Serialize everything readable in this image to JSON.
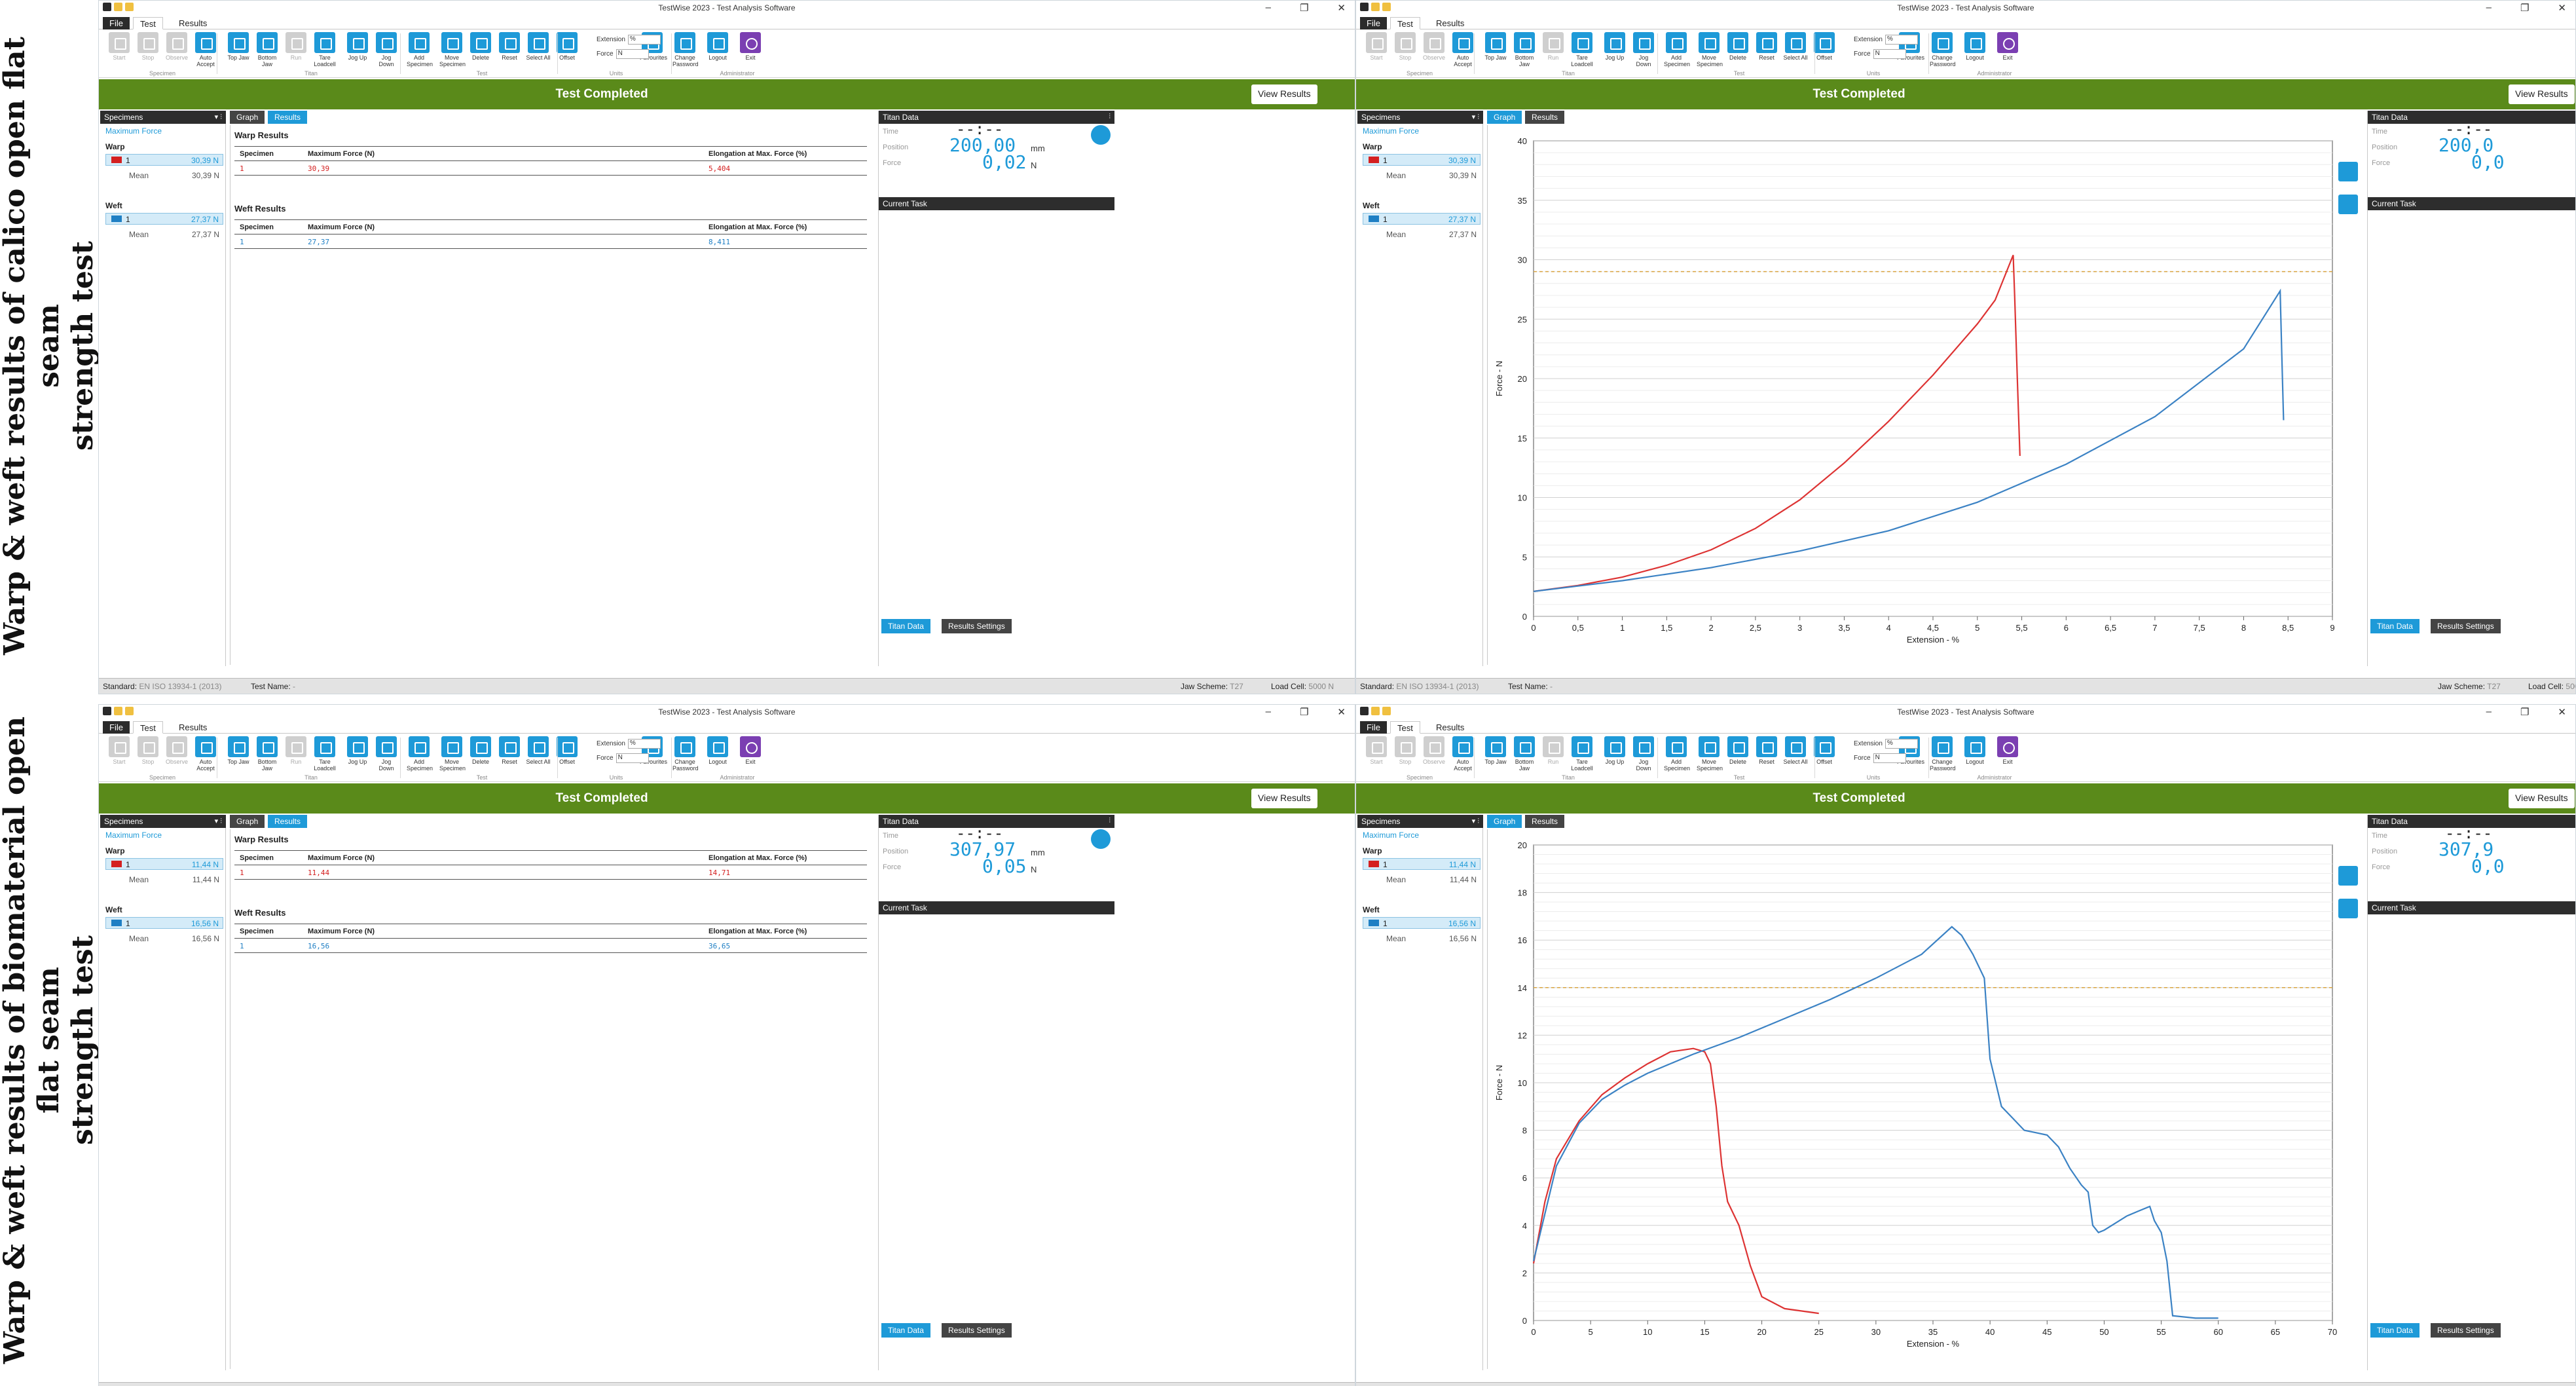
{
  "labels": {
    "top": "Warp & weft results of calico open flat seam\nstrength test",
    "bottom": "Warp & weft results of biomaterial open flat seam\nstrength test"
  },
  "app": {
    "title": "TestWise 2023 - Test Analysis Software",
    "menu": {
      "file": "File",
      "test": "Test",
      "results": "Results"
    }
  },
  "ribbon": {
    "buttons": [
      {
        "label": "Start",
        "icon": "play-icon",
        "disabled": true
      },
      {
        "label": "Stop",
        "icon": "stop-icon",
        "disabled": true
      },
      {
        "label": "Observe",
        "icon": "observe-icon",
        "disabled": true
      },
      {
        "label": "Auto Accept",
        "icon": "auto-accept-icon"
      },
      {
        "label": "Top Jaw",
        "icon": "top-jaw-icon"
      },
      {
        "label": "Bottom Jaw",
        "icon": "bottom-jaw-icon"
      },
      {
        "label": "Run",
        "icon": "run-icon",
        "disabled": true
      },
      {
        "label": "Tare Loadcell",
        "icon": "tare-icon"
      },
      {
        "label": "Jog Up",
        "icon": "jog-up-icon"
      },
      {
        "label": "Jog Down",
        "icon": "jog-down-icon"
      },
      {
        "label": "Add Specimen",
        "icon": "add-specimen-icon"
      },
      {
        "label": "Move Specimen",
        "icon": "move-specimen-icon"
      },
      {
        "label": "Delete",
        "icon": "delete-icon"
      },
      {
        "label": "Reset",
        "icon": "reset-icon"
      },
      {
        "label": "Select All",
        "icon": "select-all-icon"
      },
      {
        "label": "Offset",
        "icon": "offset-icon"
      },
      {
        "label": "Favourites",
        "icon": "star-icon"
      },
      {
        "label": "Change Password",
        "icon": "password-icon"
      },
      {
        "label": "Logout",
        "icon": "logout-icon"
      },
      {
        "label": "Exit",
        "icon": "power-icon"
      }
    ],
    "groups": {
      "specimen": "Specimen",
      "titan": "Titan",
      "test": "Test",
      "units": "Units",
      "administrator": "Administrator"
    },
    "units": {
      "extension_label": "Extension",
      "extension_value": "%",
      "force_label": "Force",
      "force_value": "N"
    }
  },
  "status": {
    "banner": "Test Completed",
    "view_results": "View Results",
    "standard_label": "Standard:",
    "standard_value": "EN ISO 13934-1 (2013)",
    "test_name_label": "Test Name:",
    "test_name_value": "-",
    "jaw_label": "Jaw Scheme:",
    "jaw_value": "T27",
    "load_label": "Load Cell:",
    "load_value": "5000 N"
  },
  "panels": {
    "specimens": "Specimens",
    "max_force": "Maximum Force",
    "warp": "Warp",
    "weft": "Weft",
    "mean": "Mean",
    "graph_tab": "Graph",
    "results_tab": "Results",
    "titan_data": "Titan Data",
    "time": "Time",
    "time_value": "--:--",
    "position": "Position",
    "force": "Force",
    "current_task": "Current Task",
    "titan_data_tab": "Titan Data",
    "results_settings_tab": "Results Settings",
    "warp_results": "Warp Results",
    "weft_results": "Weft Results",
    "col_specimen": "Specimen",
    "col_max_force": "Maximum Force (N)",
    "col_elong": "Elongation at Max. Force (%)"
  },
  "tests": {
    "calico": {
      "warp_num": "1",
      "warp_value": "30,39 N",
      "warp_mean": "30,39 N",
      "weft_num": "1",
      "weft_value": "27,37 N",
      "weft_mean": "27,37 N",
      "warp_table_force": "30,39",
      "warp_table_elong": "5,404",
      "weft_table_force": "27,37",
      "weft_table_elong": "8,411",
      "position_value": "200,00",
      "position_unit": "mm",
      "force_value": "0,02",
      "force_unit": "N",
      "position_partial": "200,0",
      "force_partial": "0,0"
    },
    "bio": {
      "warp_num": "1",
      "warp_value": "11,44 N",
      "warp_mean": "11,44 N",
      "weft_num": "1",
      "weft_value": "16,56 N",
      "weft_mean": "16,56 N",
      "warp_table_force": "11,44",
      "warp_table_elong": "14,71",
      "weft_table_force": "16,56",
      "weft_table_elong": "36,65",
      "position_value": "307,97",
      "position_unit": "mm",
      "force_value": "0,05",
      "force_unit": "N",
      "position_partial": "307,9",
      "force_partial": "0,0"
    }
  },
  "chart_data": [
    {
      "type": "line",
      "xlabel": "Extension - %",
      "ylabel": "Force - N",
      "xlim": [
        0,
        9
      ],
      "ylim": [
        0,
        40
      ],
      "xticks": [
        "0",
        "0,5",
        "1",
        "1,5",
        "2",
        "2,5",
        "3",
        "3,5",
        "4",
        "4,5",
        "5",
        "5,5",
        "6",
        "6,5",
        "7",
        "7,5",
        "8",
        "8,5",
        "9"
      ],
      "yticks": [
        "0",
        "5",
        "10",
        "15",
        "20",
        "25",
        "30",
        "35",
        "40"
      ],
      "threshold": 29,
      "series": [
        {
          "color": "#d33",
          "points": [
            [
              0,
              2.1
            ],
            [
              0.5,
              2.6
            ],
            [
              1,
              3.3
            ],
            [
              1.5,
              4.3
            ],
            [
              2,
              5.6
            ],
            [
              2.5,
              7.4
            ],
            [
              3,
              9.8
            ],
            [
              3.5,
              12.9
            ],
            [
              4,
              16.4
            ],
            [
              4.5,
              20.3
            ],
            [
              5,
              24.6
            ],
            [
              5.2,
              26.6
            ],
            [
              5.404,
              30.39
            ],
            [
              5.42,
              27
            ],
            [
              5.45,
              20
            ],
            [
              5.48,
              13.5
            ]
          ]
        },
        {
          "color": "#3b82c4",
          "points": [
            [
              0,
              2.1
            ],
            [
              1,
              3
            ],
            [
              2,
              4.1
            ],
            [
              3,
              5.5
            ],
            [
              4,
              7.2
            ],
            [
              5,
              9.6
            ],
            [
              6,
              12.8
            ],
            [
              7,
              16.8
            ],
            [
              8,
              22.5
            ],
            [
              8.411,
              27.37
            ],
            [
              8.43,
              22
            ],
            [
              8.45,
              16.5
            ]
          ]
        }
      ]
    },
    {
      "type": "line",
      "xlabel": "Extension - %",
      "ylabel": "Force - N",
      "xlim": [
        0,
        70
      ],
      "ylim": [
        0,
        20
      ],
      "xticks": [
        "0",
        "5",
        "10",
        "15",
        "20",
        "25",
        "30",
        "35",
        "40",
        "45",
        "50",
        "55",
        "60",
        "65",
        "70"
      ],
      "yticks": [
        "0",
        "2",
        "4",
        "6",
        "8",
        "10",
        "12",
        "14",
        "16",
        "18",
        "20"
      ],
      "threshold": 14,
      "series": [
        {
          "color": "#d33",
          "points": [
            [
              0,
              2.4
            ],
            [
              1,
              5
            ],
            [
              2,
              6.8
            ],
            [
              4,
              8.4
            ],
            [
              6,
              9.5
            ],
            [
              8,
              10.2
            ],
            [
              10,
              10.8
            ],
            [
              12,
              11.3
            ],
            [
              14,
              11.44
            ],
            [
              15,
              11.3
            ],
            [
              15.5,
              10.8
            ],
            [
              16,
              9
            ],
            [
              16.5,
              6.5
            ],
            [
              17,
              5
            ],
            [
              18,
              4
            ],
            [
              19,
              2.3
            ],
            [
              20,
              1
            ],
            [
              22,
              0.5
            ],
            [
              25,
              0.3
            ]
          ]
        },
        {
          "color": "#3b82c4",
          "points": [
            [
              0,
              2.5
            ],
            [
              2,
              6.5
            ],
            [
              4,
              8.3
            ],
            [
              6,
              9.3
            ],
            [
              8,
              9.9
            ],
            [
              10,
              10.4
            ],
            [
              14,
              11.2
            ],
            [
              18,
              11.9
            ],
            [
              22,
              12.7
            ],
            [
              26,
              13.5
            ],
            [
              30,
              14.4
            ],
            [
              34,
              15.4
            ],
            [
              36.65,
              16.56
            ],
            [
              37.5,
              16.2
            ],
            [
              38.5,
              15.4
            ],
            [
              39.5,
              14.4
            ],
            [
              40,
              11
            ],
            [
              41,
              9
            ],
            [
              42,
              8.5
            ],
            [
              43,
              8
            ],
            [
              44,
              7.9
            ],
            [
              45,
              7.8
            ],
            [
              46,
              7.3
            ],
            [
              47,
              6.4
            ],
            [
              48,
              5.7
            ],
            [
              48.6,
              5.4
            ],
            [
              49,
              4
            ],
            [
              49.5,
              3.7
            ],
            [
              50,
              3.8
            ],
            [
              51,
              4.1
            ],
            [
              52,
              4.4
            ],
            [
              53,
              4.6
            ],
            [
              54,
              4.8
            ],
            [
              54.4,
              4.2
            ],
            [
              55,
              3.7
            ],
            [
              55.5,
              2.5
            ],
            [
              56,
              0.2
            ],
            [
              58,
              0.1
            ],
            [
              60,
              0.1
            ]
          ]
        }
      ]
    }
  ]
}
